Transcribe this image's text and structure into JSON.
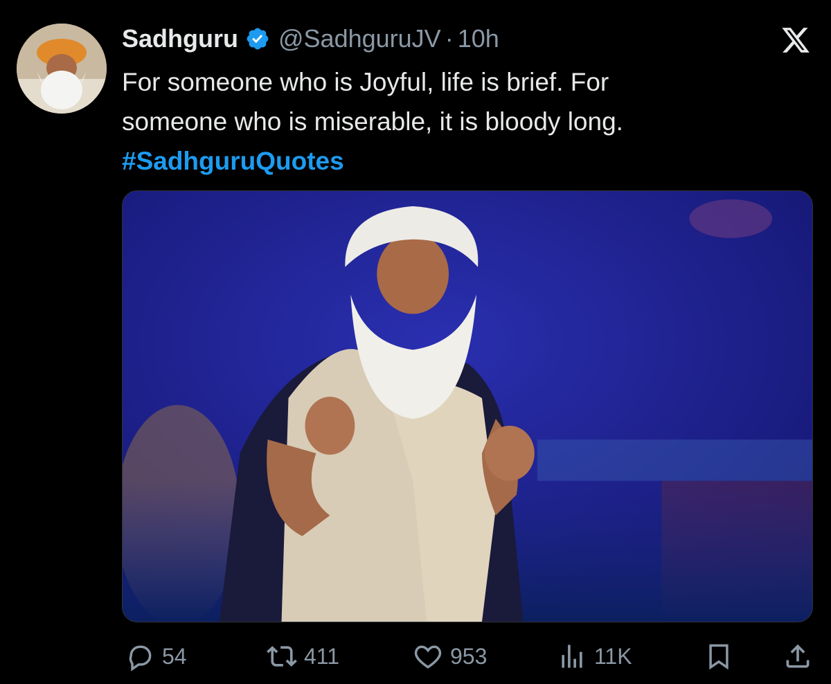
{
  "tweet": {
    "author_name": "Sadhguru",
    "handle": "@SadhguruJV",
    "separator": "·",
    "time": "10h",
    "text_lines": [
      "For someone who is Joyful, life is brief. For",
      "someone who is miserable, it is bloody long."
    ],
    "hashtag": "#SadhguruQuotes"
  },
  "icons": {
    "verified": "verified-badge-icon",
    "brand": "x-logo-icon",
    "reply": "reply-icon",
    "retweet": "retweet-icon",
    "like": "heart-icon",
    "views": "views-icon",
    "bookmark": "bookmark-icon",
    "share": "share-icon"
  },
  "stats": {
    "replies": "54",
    "retweets": "411",
    "likes": "953",
    "views": "11K"
  },
  "colors": {
    "background": "#000000",
    "text": "#e7e9ea",
    "muted": "#8b98a5",
    "accent": "#1d9bf0",
    "media_bg": "#1b1d80"
  }
}
